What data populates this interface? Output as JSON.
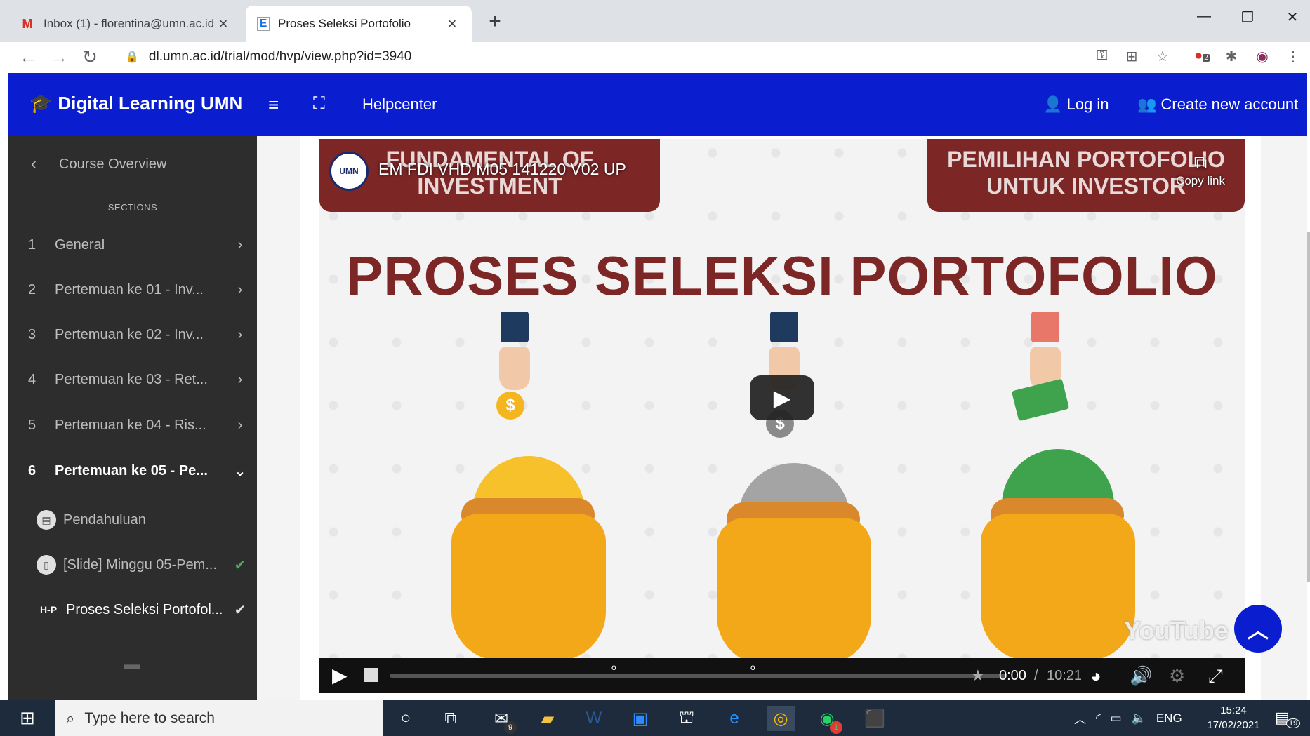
{
  "browser": {
    "tabs": [
      {
        "title": "Inbox (1) - florentina@umn.ac.id",
        "favicon": "gmail-icon"
      },
      {
        "title": "Proses Seleksi Portofolio",
        "favicon": "moodle-page-icon"
      }
    ],
    "url": "dl.umn.ac.id/trial/mod/hvp/view.php?id=3940",
    "extension_badge": "2"
  },
  "navbar": {
    "brand": "Digital Learning UMN",
    "helpcenter": "Helpcenter",
    "login": "Log in",
    "create_account": "Create new account"
  },
  "sidebar": {
    "course_overview": "Course Overview",
    "sections_label": "SECTIONS",
    "sections": [
      {
        "num": "1",
        "label": "General"
      },
      {
        "num": "2",
        "label": "Pertemuan ke 01 - Inv..."
      },
      {
        "num": "3",
        "label": "Pertemuan ke 02 - Inv..."
      },
      {
        "num": "4",
        "label": "Pertemuan ke 03 - Ret..."
      },
      {
        "num": "5",
        "label": "Pertemuan ke 04 - Ris..."
      },
      {
        "num": "6",
        "label": "Pertemuan ke 05 - Pe..."
      }
    ],
    "activities": [
      {
        "label": "Pendahuluan",
        "completed": false
      },
      {
        "label": "[Slide] Minggu 05-Pem...",
        "completed": true
      },
      {
        "label": "Proses Seleksi Portofol...",
        "completed": true,
        "icon_text": "H-P"
      }
    ]
  },
  "video": {
    "banner_left": "FUNDAMENTAL OF INVESTMENT",
    "banner_left_line1": "FUNDAMENTAL OF",
    "banner_left_line2": "INVESTMENT",
    "banner_right_line1": "PEMILIHAN PORTOFOLIO",
    "banner_right_line2": "UNTUK INVESTOR",
    "overlay_title": "EM FDI VHD M05 141220 V02 UP",
    "channel_logo": "UMN",
    "copy_link": "Copy link",
    "headline": "PROSES SELEKSI PORTOFOLIO",
    "watermark": "YouTube",
    "time_current": "0:00",
    "time_total": "10:21"
  },
  "taskbar": {
    "search_placeholder": "Type here to search",
    "mail_badge": "9",
    "whatsapp_badge": "1",
    "language": "ENG",
    "time": "15:24",
    "date": "17/02/2021",
    "notifications": "19"
  },
  "colors": {
    "navbar": "#0a1ed0",
    "sidebar": "#2d2d2d",
    "banner": "#7d2626",
    "check": "#4caf50"
  }
}
